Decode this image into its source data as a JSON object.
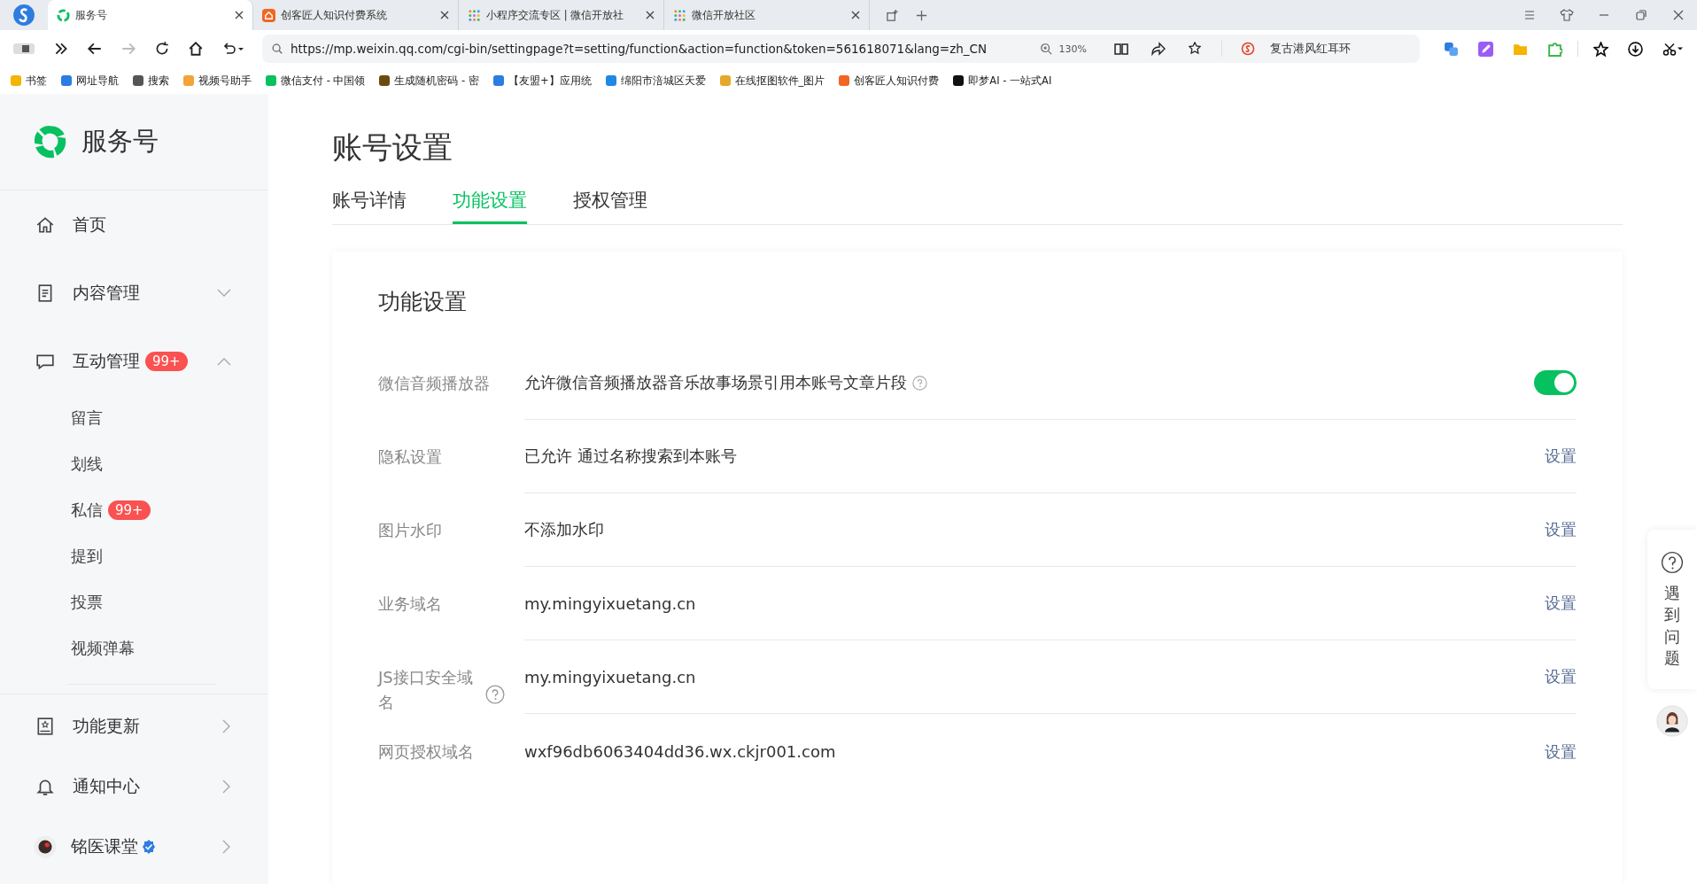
{
  "browser": {
    "tabs": [
      {
        "title": "服务号",
        "selected": true
      },
      {
        "title": "创客匠人知识付费系统",
        "selected": false
      },
      {
        "title": "小程序交流专区 | 微信开放社",
        "selected": false
      },
      {
        "title": "微信开放社区",
        "selected": false
      }
    ],
    "address_bar": {
      "url": "https://mp.weixin.qq.com/cgi-bin/settingpage?t=setting/function&action=function&token=561618071&lang=zh_CN",
      "zoom": "130%",
      "search": "复古港风红耳环"
    },
    "bookmarks": [
      {
        "label": "书签",
        "color": "#f5b400"
      },
      {
        "label": "网址导航",
        "color": "#2a7de1"
      },
      {
        "label": "搜索",
        "color": "#555555"
      },
      {
        "label": "视频号助手",
        "color": "#f2a33a"
      },
      {
        "label": "微信支付 - 中国领",
        "color": "#07c160"
      },
      {
        "label": "生成随机密码 - 密",
        "color": "#6b4a10"
      },
      {
        "label": "【友盟+】应用统",
        "color": "#2a7de1"
      },
      {
        "label": "绵阳市涪城区天爱",
        "color": "#1e88e5"
      },
      {
        "label": "在线抠图软件_图片",
        "color": "#e5a82a"
      },
      {
        "label": "创客匠人知识付费",
        "color": "#f26522"
      },
      {
        "label": "即梦AI - 一站式AI",
        "color": "#111111"
      }
    ]
  },
  "sidebar": {
    "brand": "服务号",
    "nav": [
      {
        "label": "首页",
        "kind": "link"
      },
      {
        "label": "内容管理",
        "kind": "group",
        "expanded": false
      },
      {
        "label": "互动管理",
        "kind": "group",
        "expanded": true,
        "badge": "99+",
        "children": [
          {
            "label": "留言"
          },
          {
            "label": "划线"
          },
          {
            "label": "私信",
            "badge": "99+"
          },
          {
            "label": "提到"
          },
          {
            "label": "投票"
          },
          {
            "label": "视频弹幕"
          }
        ]
      }
    ],
    "footer": [
      {
        "label": "功能更新",
        "kind": "link"
      },
      {
        "label": "通知中心",
        "kind": "link"
      },
      {
        "label": "铭医课堂",
        "kind": "account",
        "verified": true
      }
    ]
  },
  "page": {
    "title": "账号设置",
    "tabs": [
      {
        "label": "账号详情",
        "selected": false
      },
      {
        "label": "功能设置",
        "selected": true
      },
      {
        "label": "授权管理",
        "selected": false
      }
    ],
    "card": {
      "title": "功能设置",
      "rows": [
        {
          "label": "微信音频播放器",
          "value": "允许微信音频播放器音乐故事场景引用本账号文章片段",
          "value_help": true,
          "kind": "toggle",
          "on": true
        },
        {
          "label": "隐私设置",
          "value": "已允许 通过名称搜索到本账号",
          "kind": "link",
          "action": "设置"
        },
        {
          "label": "图片水印",
          "value": "不添加水印",
          "kind": "link",
          "action": "设置"
        },
        {
          "label": "业务域名",
          "value": "my.mingyixuetang.cn",
          "kind": "link",
          "action": "设置"
        },
        {
          "label": "JS接口安全域名",
          "label_help": true,
          "value": "my.mingyixuetang.cn",
          "kind": "link",
          "action": "设置"
        },
        {
          "label": "网页授权域名",
          "value": "wxf96db6063404dd36.wx.ckjr001.com",
          "kind": "link",
          "action": "设置"
        }
      ]
    }
  },
  "help_widget": {
    "text": "遇到问题"
  }
}
